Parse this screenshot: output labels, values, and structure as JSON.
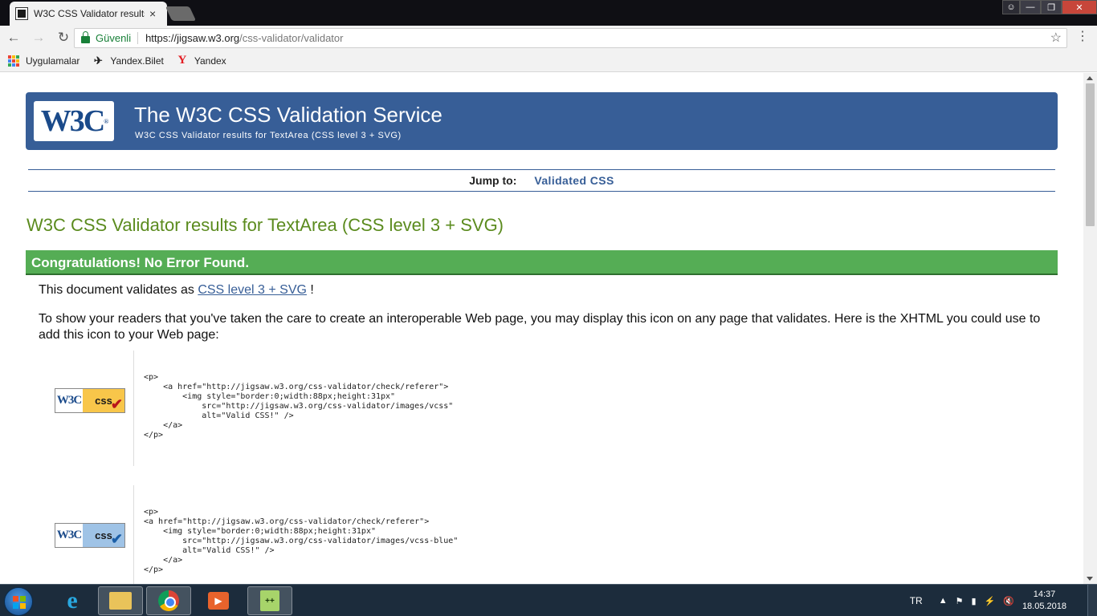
{
  "browser": {
    "tab_title": "W3C CSS Validator results",
    "tab_close": "×",
    "secure_label": "Güvenli",
    "url_host": "https://jigsaw.w3.org",
    "url_path": "/css-validator/validator",
    "bookmarks": [
      {
        "label": "Uygulamalar",
        "icon": "apps-grid-icon"
      },
      {
        "label": "Yandex.Bilet",
        "icon": "plane-icon"
      },
      {
        "label": "Yandex",
        "icon": "yandex-icon"
      }
    ]
  },
  "page": {
    "banner_title": "The W3C CSS Validation Service",
    "banner_subtitle": "W3C CSS Validator results for TextArea (CSS level 3 + SVG)",
    "logo_text": "W3C",
    "jump_label": "Jump to:",
    "jump_link": "Validated CSS",
    "results_heading": "W3C CSS Validator results for TextArea (CSS level 3 + SVG)",
    "congrats": "Congratulations! No Error Found.",
    "validates_prefix": "This document validates as",
    "validates_link": "CSS level 3 + SVG",
    "validates_suffix": "!",
    "icon_note": "To show your readers that you've taken the care to create an interoperable Web page, you may display this icon on any page that validates. Here is the XHTML you could use to add this icon to your Web page:",
    "badges": [
      {
        "w3c": "W3C",
        "css": "css",
        "check": "✔",
        "variant": "gold",
        "code": "<p>\n    <a href=\"http://jigsaw.w3.org/css-validator/check/referer\">\n        <img style=\"border:0;width:88px;height:31px\"\n            src=\"http://jigsaw.w3.org/css-validator/images/vcss\"\n            alt=\"Valid CSS!\" />\n    </a>\n</p>"
      },
      {
        "w3c": "W3C",
        "css": "css",
        "check": "✔",
        "variant": "blue",
        "code": "<p>\n<a href=\"http://jigsaw.w3.org/css-validator/check/referer\">\n    <img style=\"border:0;width:88px;height:31px\"\n        src=\"http://jigsaw.w3.org/css-validator/images/vcss-blue\"\n        alt=\"Valid CSS!\" />\n    </a>\n</p>"
      }
    ]
  },
  "taskbar": {
    "language": "TR",
    "time": "14:37",
    "date": "18.05.2018",
    "apps": [
      "internet-explorer",
      "file-explorer",
      "chrome",
      "media-player",
      "notepad-plus-plus"
    ]
  },
  "colors": {
    "banner_blue": "#375e97",
    "heading_green": "#5b8b1e",
    "congrats_green": "#55ad55"
  }
}
